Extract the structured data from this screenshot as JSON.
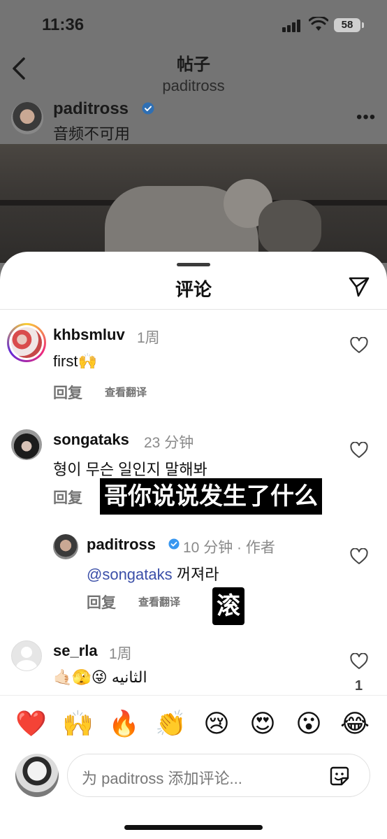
{
  "status_bar": {
    "time": "11:36",
    "battery": "58"
  },
  "nav": {
    "title": "帖子",
    "subtitle": "paditross"
  },
  "post": {
    "username": "paditross",
    "subtitle": "音频不可用"
  },
  "sheet": {
    "title": "评论"
  },
  "comments": [
    {
      "username": "khbsmluv",
      "time": "1周",
      "text": "first🙌",
      "reply": "回复",
      "translate": "查看翻译"
    },
    {
      "username": "songataks",
      "time": "23 分钟",
      "text": "형이 무슨 일인지 말해봐",
      "reply": "回复",
      "subtitle": "哥你说说发生了什么"
    },
    {
      "username": "paditross",
      "time": "10 分钟 · 作者",
      "mention": "@songataks",
      "text": "꺼져라",
      "reply": "回复",
      "translate": "查看翻译",
      "subtitle": "滚"
    },
    {
      "username": "se_rla",
      "time": "1周",
      "text": "🤙🏻🫣😜 الثانيه",
      "likes": "1"
    }
  ],
  "emoji_bar": [
    "❤️",
    "🙌",
    "🔥",
    "👏",
    "😢",
    "😍",
    "😮",
    "😂"
  ],
  "input": {
    "placeholder": "为 paditross 添加评论..."
  },
  "icons": {
    "back": "chevron-left-icon",
    "verified": "verified-badge-icon",
    "send": "paper-plane-icon",
    "heart": "heart-outline-icon",
    "sticker": "sticker-icon"
  },
  "colors": {
    "verified": "#3897f0",
    "mention": "#3b4fa8"
  }
}
